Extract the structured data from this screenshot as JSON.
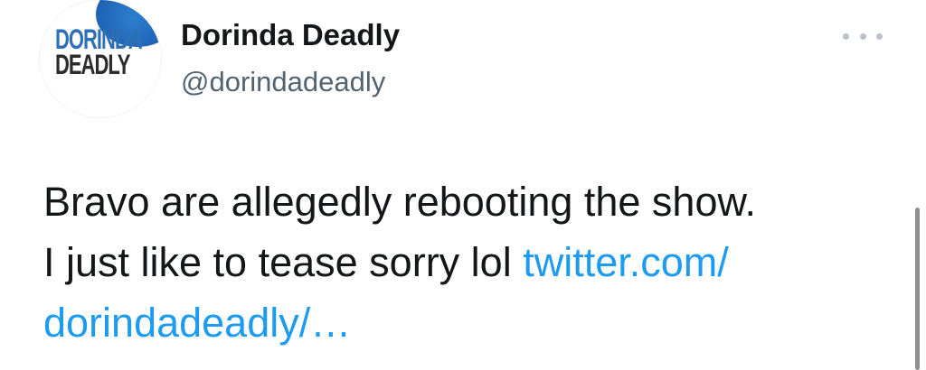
{
  "profile": {
    "avatar_logo_line1": "DORINDA",
    "avatar_logo_line2": "DEADLY",
    "display_name": "Dorinda Deadly",
    "handle": "@dorindadeadly"
  },
  "tweet": {
    "line1": "Bravo are allegedly rebooting the show.",
    "line2_text": "I just like to tease sorry lol ",
    "link_part1": "twitter.com/",
    "link_part2": "dorindadeadly/…"
  },
  "icons": {
    "more": "more-horizontal-icon"
  },
  "colors": {
    "link": "#1d9bf0",
    "text": "#14171a",
    "secondary": "#536471",
    "avatar_blue": "#1d5fb0"
  }
}
